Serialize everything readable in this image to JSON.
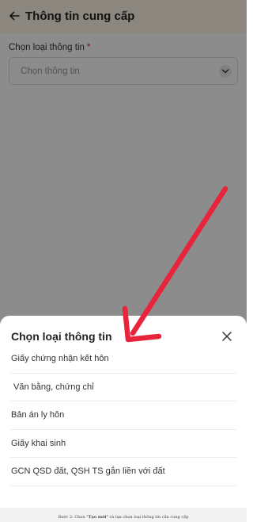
{
  "header": {
    "title": "Thông tin cung cấp",
    "back_icon": "arrow-left-icon"
  },
  "form": {
    "label": "Chọn loại thông tin",
    "required_mark": "*",
    "placeholder": "Chọn thông tin",
    "chevron_icon": "chevron-down-icon"
  },
  "sheet": {
    "title": "Chọn loại thông tin",
    "close_icon": "close-icon",
    "items": [
      {
        "label": "Giấy chứng nhận kết hôn"
      },
      {
        "label": " Văn bằng, chứng chỉ"
      },
      {
        "label": "Bản án ly hôn"
      },
      {
        "label": "Giấy khai sinh"
      },
      {
        "label": "GCN QSD đất, QSH TS gắn liền với đất"
      }
    ]
  },
  "caption": {
    "prefix": "Bước 2: Chọn ",
    "bold": "\"Tạo mới\"",
    "suffix": " và lựa chọn loại thông tin cần cung cấp"
  },
  "colors": {
    "header_bg": "#fdf6e6",
    "required": "#d8242b",
    "annotation_arrow": "#e8233a"
  }
}
